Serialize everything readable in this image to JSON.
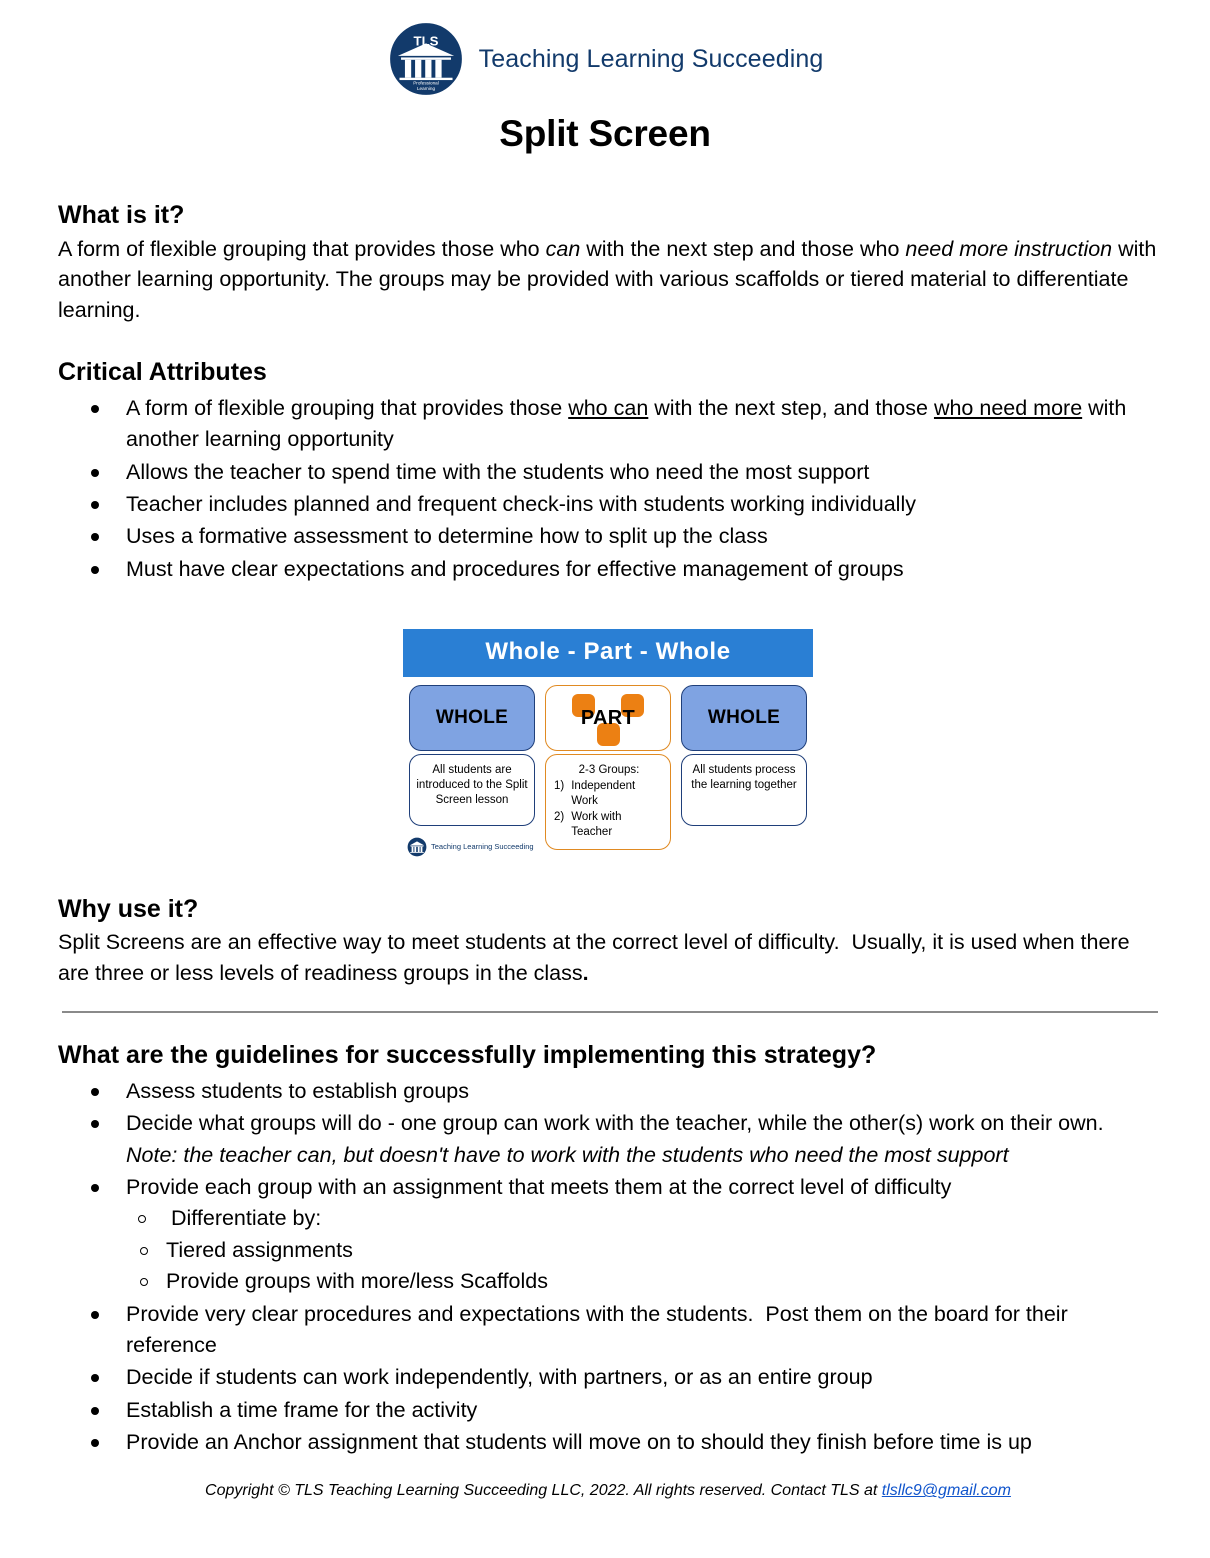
{
  "brand": {
    "name": "Teaching Learning Succeeding",
    "logo_initials": "TLS",
    "logo_subtext_line1": "Professional",
    "logo_subtext_line2": "Learning",
    "logo_color": "#123a6b"
  },
  "title": "Split Screen",
  "sections": {
    "what_is_it": {
      "heading": "What is it?",
      "paragraph_html": "A form of flexible grouping that provides those who <i>can</i> with the next step and those who <i>need more instruction</i> with another learning opportunity. The groups may be provided with various scaffolds or tiered material to differentiate learning."
    },
    "critical_attributes": {
      "heading": "Critical Attributes",
      "items_html": [
        "A form of flexible grouping that provides those <span class=\"u\">who can</span> with the next step, and those <span class=\"u\">who need more</span> with another learning opportunity",
        "Allows the teacher to spend time with the students who need the most support",
        "Teacher includes planned and frequent check-ins with students working individually",
        "Uses a formative assessment to determine how to split up the class",
        "Must have clear expectations and procedures for effective management of groups"
      ]
    },
    "why_use_it": {
      "heading": "Why use it?",
      "paragraph_html": "Split Screens are an effective way to meet students at the correct level of difficulty.&nbsp; Usually, it is used when there are three or less levels of readiness groups in the class<b>.</b>"
    },
    "guidelines": {
      "heading": "What are the guidelines for successfully implementing this strategy?",
      "items_html": [
        "Assess students to establish groups",
        "Decide what groups will do - one group can work with the teacher, while the other(s) work on their own. <span class=\"it\">Note: the teacher can, but doesn't have to work with the students who need the most support</span>",
        "Provide each group with an assignment that meets them at the correct level of difficulty",
        "Provide very clear procedures and expectations with the students.&nbsp; Post them on the board for their reference",
        "Decide if students can work independently, with partners, or as an entire group",
        "Establish a time frame for the activity",
        "Provide an Anchor assignment that students will move on to should they finish before time is up"
      ],
      "sub_label": "Differentiate by:",
      "sub_items": [
        "Tiered assignments",
        "Provide groups with more/less Scaffolds"
      ]
    }
  },
  "diagram": {
    "header": "Whole - Part - Whole",
    "header_color": "#2a7fd4",
    "whole_fill": "#7fa3e2",
    "whole_border": "#1f3f7a",
    "part_border": "#e08a22",
    "part_square_color": "#ec8013",
    "columns": [
      {
        "caption": "WHOLE",
        "description": "All students are introduced to the Split Screen lesson"
      },
      {
        "caption": "PART",
        "description_title": "2-3 Groups:",
        "description_items": [
          {
            "num": "1)",
            "text": "Independent Work"
          },
          {
            "num": "2)",
            "text": "Work with Teacher"
          }
        ]
      },
      {
        "caption": "WHOLE",
        "description": "All students process the learning together"
      }
    ],
    "footer_brand": "Teaching Learning Succeeding"
  },
  "footer": {
    "copyright_prefix": "Copyright © TLS Teaching Learning Succeeding LLC, 2022. All rights reserved. Contact TLS at ",
    "email": "tlsllc9@gmail.com",
    "email_color": "#1155cc"
  }
}
